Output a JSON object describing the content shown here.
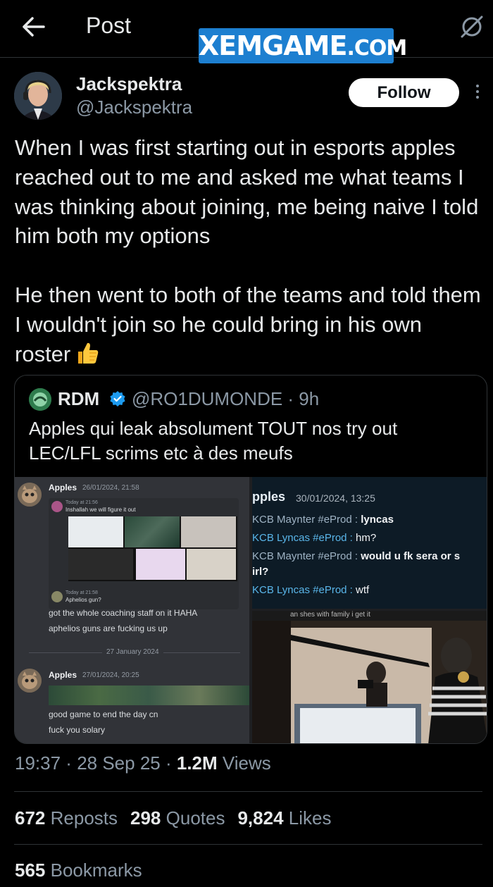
{
  "header": {
    "title": "Post",
    "watermark_main": "XEMGAME",
    "watermark_suffix": ".COM"
  },
  "author": {
    "display_name": "Jackspektra",
    "handle": "@Jackspektra",
    "follow_label": "Follow"
  },
  "post": {
    "paragraph1": "When I was first starting out in esports apples reached out to me and asked me what teams I was thinking about joining, me being naive I told him both my options",
    "paragraph2": "He then went to both of the teams and told them I wouldn't join so he could bring in his own roster",
    "emoji": "thumbs-up"
  },
  "quote": {
    "display_name": "RDM",
    "handle": "@RO1DUMONDE · 9h",
    "text": "Apples qui leak absolument TOUT nos try out LEC/LFL scrims etc à des meufs",
    "media": {
      "left": {
        "msg1_author": "Apples",
        "msg1_time": "26/01/2024, 21:58",
        "embed_line1": "Inshallah we will figure it out",
        "embed_line2": "Aphelios gun?",
        "embed_today1": "Today at 21:56",
        "embed_today2": "Today at 21:58",
        "msg1_text1": "got the whole coaching staff on it HAHA",
        "msg1_text2": "aphelios guns are fucking us up",
        "separator": "27 January 2024",
        "msg2_author": "Apples",
        "msg2_time": "27/01/2024, 20:25",
        "msg2_text1": "good game to end the day cn",
        "msg2_text2": "fuck you solary"
      },
      "right_top": {
        "author": "pples",
        "date": "30/01/2024, 13:25",
        "lines": [
          {
            "who": "KCB Maynter #eProd : ",
            "msg": "lyncas"
          },
          {
            "who": "KCB Lyncas #eProd : ",
            "msg": "hm?"
          },
          {
            "who": "KCB Maynter #eProd : ",
            "msg": "would u fk sera or s"
          },
          {
            "who": "",
            "msg": "irl?"
          },
          {
            "who": "KCB Lyncas #eProd : ",
            "msg": "wtf"
          }
        ]
      },
      "right_bottom": {
        "caption": "an shes with family i get it"
      }
    }
  },
  "meta": {
    "time": "19:37",
    "date": "28 Sep 25",
    "views_count": "1.2M",
    "views_label": "Views"
  },
  "stats": {
    "reposts_count": "672",
    "reposts_label": "Reposts",
    "quotes_count": "298",
    "quotes_label": "Quotes",
    "likes_count": "9,824",
    "likes_label": "Likes",
    "bookmarks_count": "565",
    "bookmarks_label": "Bookmarks"
  },
  "colors": {
    "background": "#000000",
    "text": "#e7e9ea",
    "muted": "#8b98a5",
    "border": "#2f3336",
    "verified": "#1d9bf0",
    "watermark": "#1d7fd0"
  }
}
